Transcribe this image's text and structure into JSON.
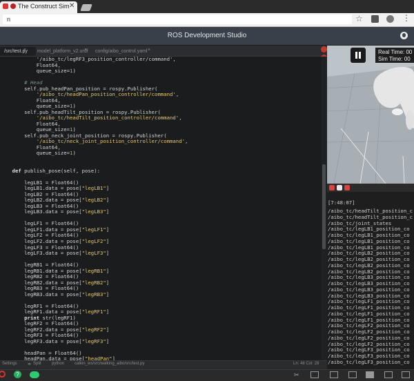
{
  "browser": {
    "tab_title": "The Construct Sim",
    "url": "n"
  },
  "app": {
    "title": "ROS Development Studio"
  },
  "editor": {
    "tabs": [
      {
        "label": "/src/test.py"
      },
      {
        "label": "model_platform_v2.urdf"
      },
      {
        "label": "config/aibo_control.yaml"
      }
    ],
    "status": {
      "settings": "Settings",
      "split": "Split",
      "language": "python",
      "path": "catkin_ws/src/walking_aibo/src/test.py",
      "position": "Ln: 48 Col: 28"
    }
  },
  "simulation": {
    "real_time_label": "Real Time: 00",
    "sim_time_label": "Sim Time: 00"
  },
  "log": {
    "timestamp": "[7:48:07]",
    "lines": [
      "/aibo_tc/headTilt_position_c",
      "/aibo_tc/headTilt_position_c",
      "/aibo_tc/joint_states",
      "/aibo_tc/legLB1_position_co",
      "/aibo_tc/legLB1_position_co",
      "/aibo_tc/legLB1_position_co",
      "/aibo_tc/legLB1_position_co",
      "/aibo_tc/legLB2_position_co",
      "/aibo_tc/legLB2_position_co",
      "/aibo_tc/legLB2_position_co",
      "/aibo_tc/legLB2_position_co",
      "/aibo_tc/legLB3_position_co",
      "/aibo_tc/legLB3_position_co",
      "/aibo_tc/legLB3_position_co",
      "/aibo_tc/legLB3_position_co",
      "/aibo_tc/legLF1_position_co",
      "/aibo_tc/legLF1_position_co",
      "/aibo_tc/legLF1_position_co",
      "/aibo_tc/legLF1_position_co",
      "/aibo_tc/legLF2_position_co",
      "/aibo_tc/legLF2_position_co",
      "/aibo_tc/legLF2_position_co",
      "/aibo_tc/legLF2_position_co",
      "/aibo_tc/legLF3_position_co",
      "/aibo_tc/legLF3_position_co",
      "/aibo_tc/legLF3_position_co"
    ]
  }
}
